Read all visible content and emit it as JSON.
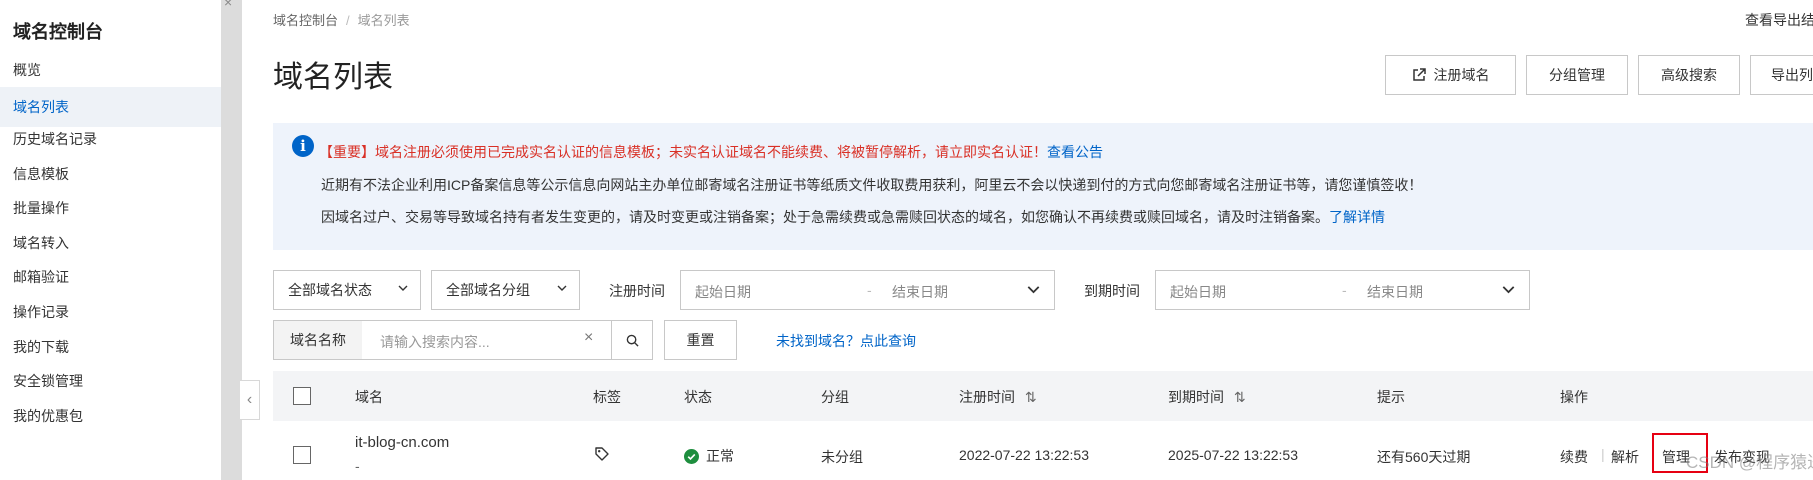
{
  "sidebar": {
    "title": "域名控制台",
    "items": [
      {
        "label": "概览",
        "active": false
      },
      {
        "label": "域名列表",
        "active": true
      },
      {
        "label": "历史域名记录",
        "active": false
      },
      {
        "label": "信息模板",
        "active": false
      },
      {
        "label": "批量操作",
        "active": false
      },
      {
        "label": "域名转入",
        "active": false
      },
      {
        "label": "邮箱验证",
        "active": false
      },
      {
        "label": "操作记录",
        "active": false
      },
      {
        "label": "我的下载",
        "active": false
      },
      {
        "label": "安全锁管理",
        "active": false
      },
      {
        "label": "我的优惠包",
        "active": false
      }
    ],
    "close_glyph": "×",
    "collapse_glyph": "‹"
  },
  "breadcrumb": {
    "root": "域名控制台",
    "separator": "/",
    "current": "域名列表"
  },
  "header": {
    "export_link": "查看导出结果",
    "title": "域名列表"
  },
  "toolbar": {
    "register_label": "注册域名",
    "group_label": "分组管理",
    "advanced_search_label": "高级搜索",
    "export_label": "导出列表"
  },
  "notice": {
    "line1": "【重要】域名注册必须使用已完成实名认证的信息模板；未实名认证域名不能续费、将被暂停解析，请立即实名认证！",
    "line1_link": "查看公告",
    "line2": "近期有不法企业利用ICP备案信息等公示信息向网站主办单位邮寄域名注册证书等纸质文件收取费用获利，阿里云不会以快递到付的方式向您邮寄域名注册证书等，请您谨慎签收！",
    "line3": "因域名过户、交易等导致域名持有者发生变更的，请及时变更或注销备案；处于急需续费或急需赎回状态的域名，如您确认不再续费或赎回域名，请及时注销备案。",
    "line3_link": "了解详情"
  },
  "filters": {
    "status_select": "全部域名状态",
    "group_select": "全部域名分组",
    "reg_time_label": "注册时间",
    "reg_start_placeholder": "起始日期",
    "reg_end_placeholder": "结束日期",
    "exp_time_label": "到期时间",
    "exp_start_placeholder": "起始日期",
    "exp_end_placeholder": "结束日期",
    "range_sep": "-",
    "search_prefix": "域名名称",
    "search_placeholder": "请输入搜索内容...",
    "clear_glyph": "×",
    "reset_label": "重置",
    "not_found_link": "未找到域名？点此查询"
  },
  "table": {
    "columns": [
      "域名",
      "标签",
      "状态",
      "分组",
      "注册时间",
      "到期时间",
      "提示",
      "操作"
    ],
    "sort_glyph": "⇅",
    "rows": [
      {
        "domain": "it-blog-cn.com",
        "sub": "-",
        "status": "正常",
        "group": "未分组",
        "reg_time": "2022-07-22 13:22:53",
        "exp_time": "2025-07-22 13:22:53",
        "hint": "还有560天过期",
        "actions": [
          "续费",
          "解析",
          "管理",
          "发布变现"
        ]
      }
    ]
  },
  "watermark": "CSDN @程序猿进阶",
  "colors": {
    "accent": "#0064c8",
    "alert": "#d93026",
    "success": "#1e8e3e",
    "highlight_box": "#e60012"
  }
}
